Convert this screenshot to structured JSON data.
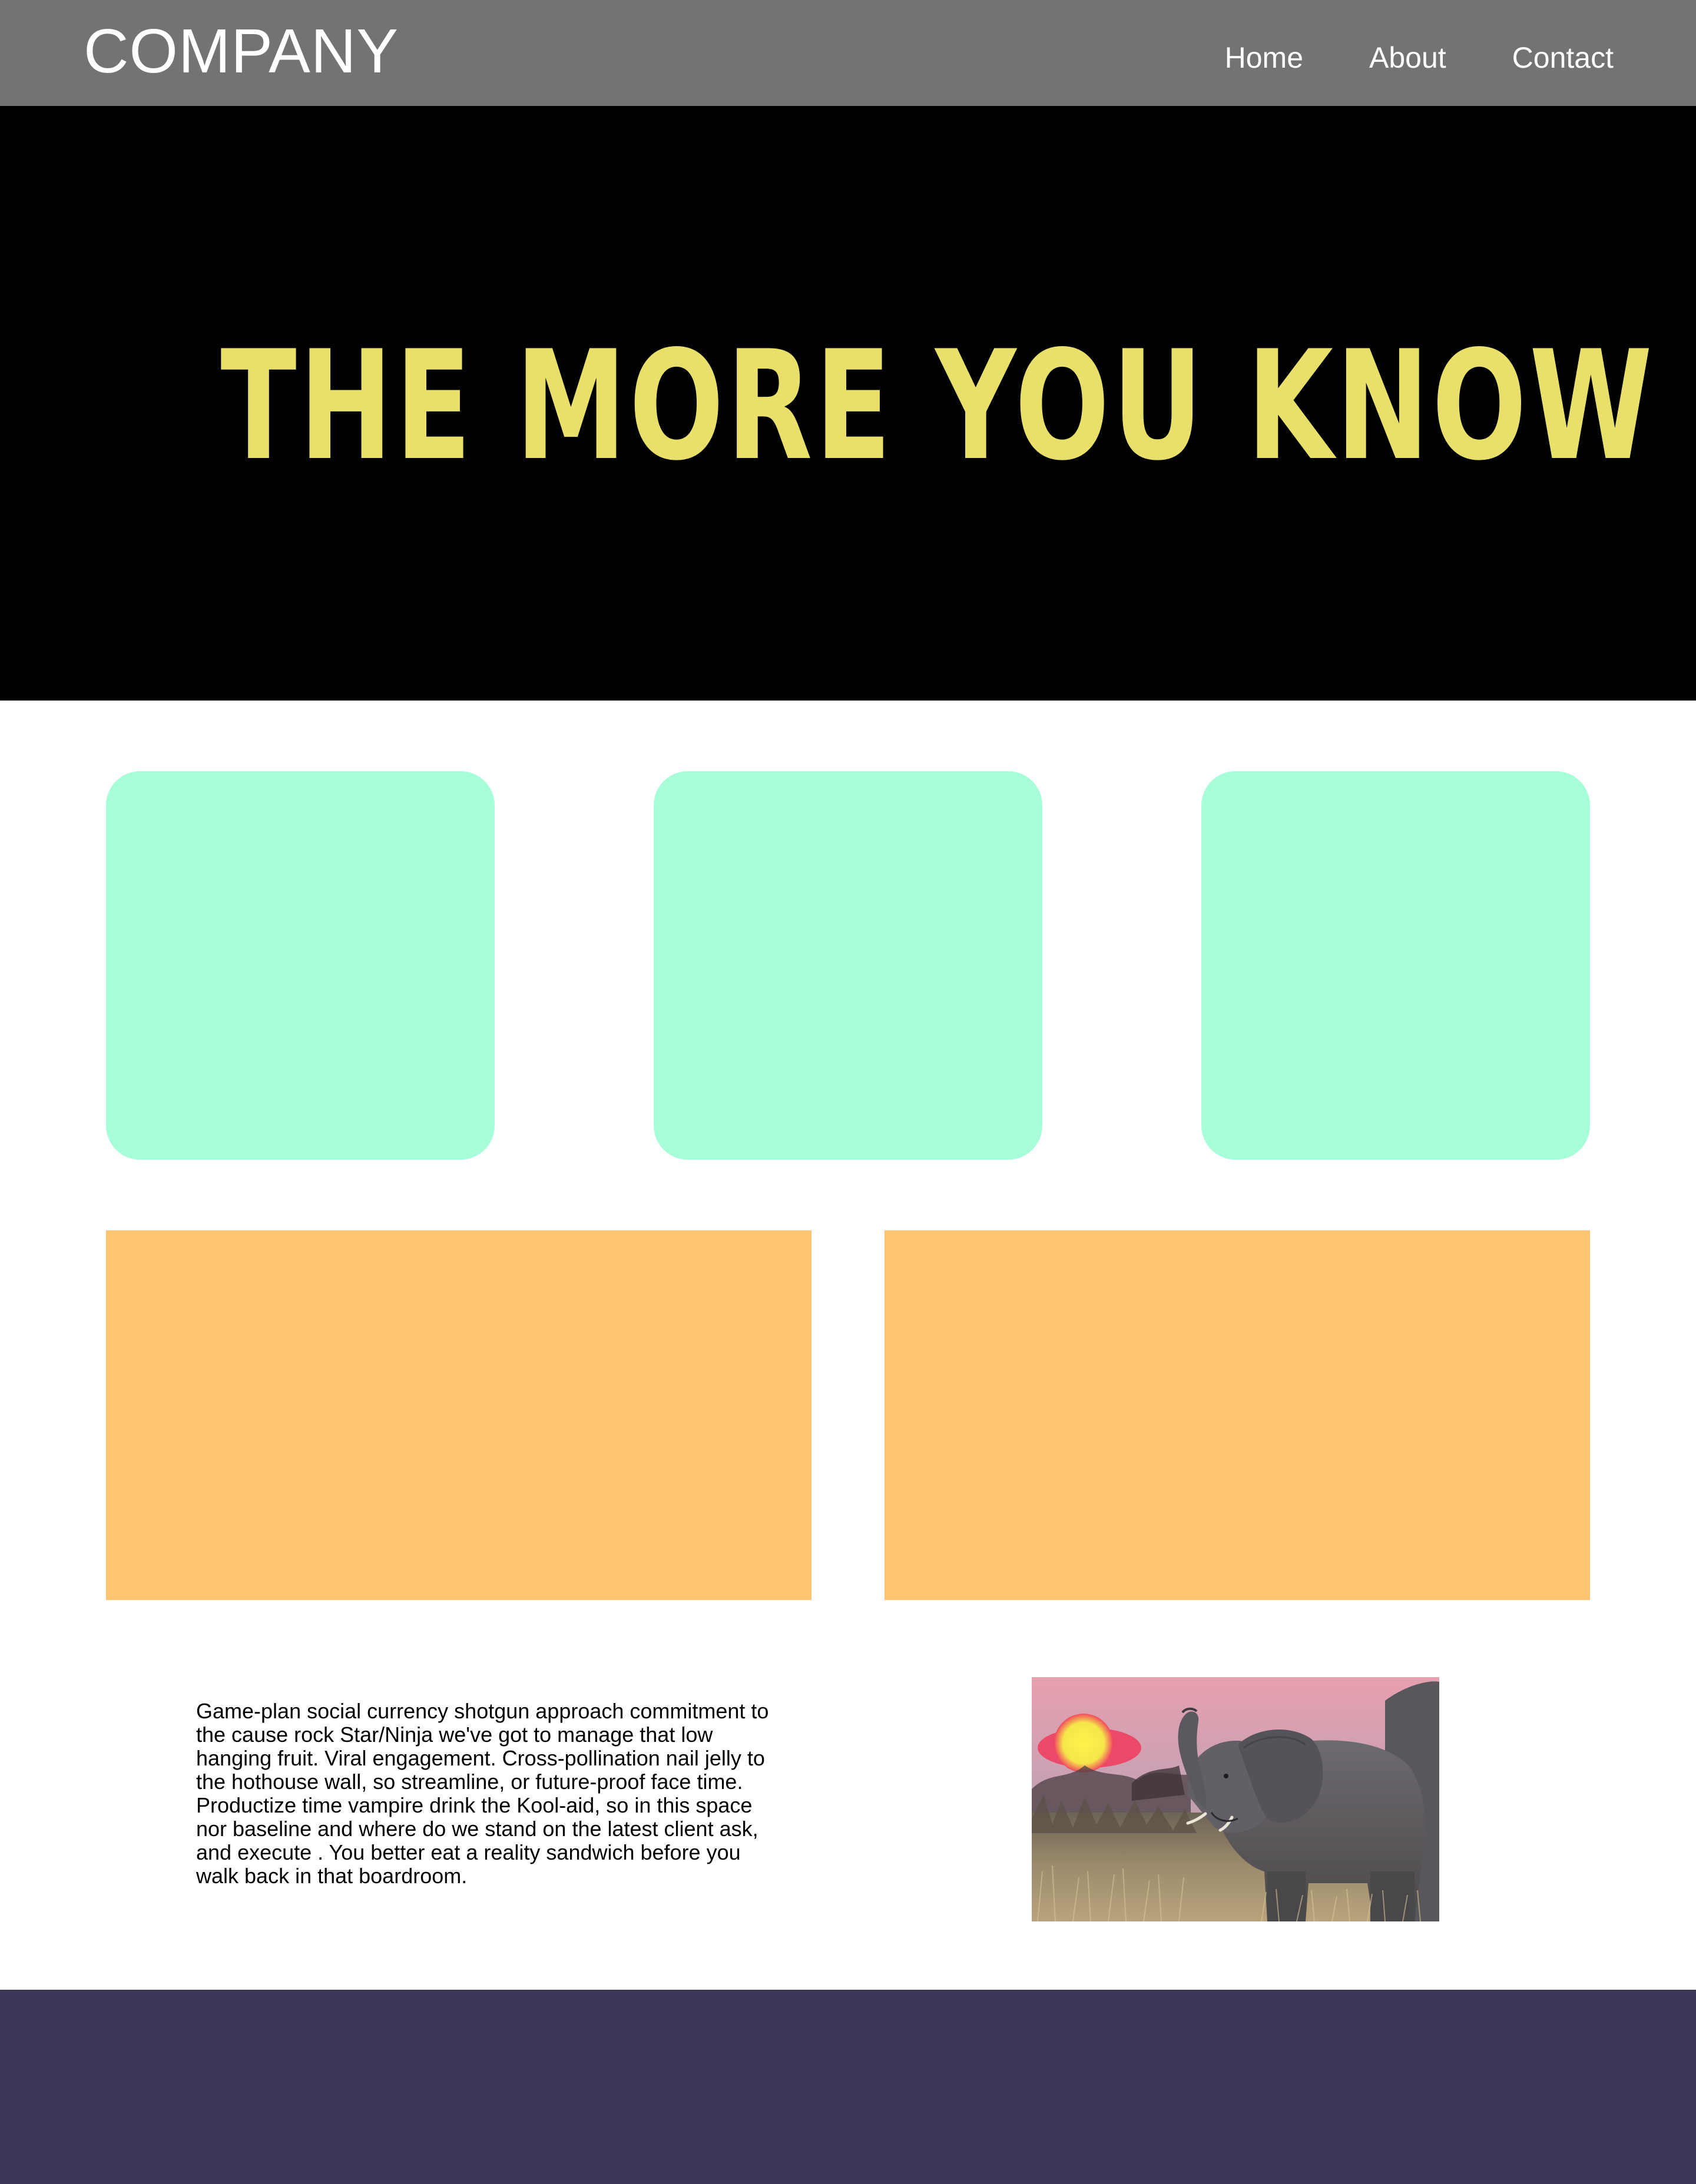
{
  "header": {
    "logo_text": "COMPANY",
    "nav": [
      {
        "label": "Home"
      },
      {
        "label": "About"
      },
      {
        "label": "Contact"
      }
    ]
  },
  "hero": {
    "title": "THE MORE YOU KNOW"
  },
  "content": {
    "paragraph": " Game-plan social currency shotgun approach commitment to the cause rock Star/Ninja we've got to manage that low hanging fruit. Viral engagement. Cross-pollination nail jelly to the hothouse wall, so streamline, or future-proof face time. Productize time vampire drink the Kool-aid, so in this space nor baseline and where do we stand on the latest client ask, and execute . You better eat a reality sandwich before you walk back in that boardroom."
  },
  "colors": {
    "header_bg": "#737373",
    "hero_bg": "#000000",
    "hero_text": "#e8e06a",
    "card_bg": "#a6ffd8",
    "panel_bg": "#fec46f",
    "footer_bg": "#3a3856"
  }
}
